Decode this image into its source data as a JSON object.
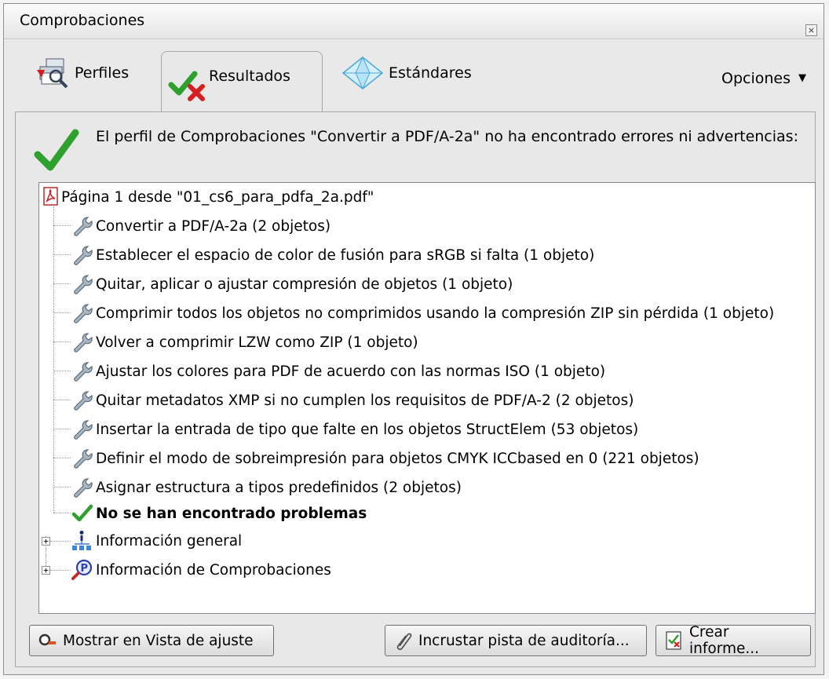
{
  "window": {
    "title": "Comprobaciones",
    "close_glyph": "×"
  },
  "tabs": [
    {
      "label": "Perfiles",
      "icon": "profiles-icon",
      "active": false
    },
    {
      "label": "Resultados",
      "icon": "results-icon",
      "active": true
    },
    {
      "label": "Estándares",
      "icon": "standards-icon",
      "active": false
    }
  ],
  "options": {
    "label": "Opciones",
    "caret": "▼"
  },
  "summary": {
    "message": "El perfil de Comprobaciones \"Convertir a PDF/A-2a\" no ha encontrado errores ni advertencias:"
  },
  "tree": {
    "root": {
      "label": "Página 1 desde \"01_cs6_para_pdfa_2a.pdf\"",
      "icon": "pdf-icon"
    },
    "fixups": [
      "Convertir a PDF/A-2a (2 objetos)",
      "Establecer el espacio de color de fusión para sRGB si falta (1 objeto)",
      "Quitar, aplicar o ajustar compresión de objetos (1 objeto)",
      "Comprimir todos los objetos no comprimidos usando la compresión ZIP sin pérdida (1 objeto)",
      "Volver a comprimir LZW como ZIP (1 objeto)",
      "Ajustar los colores para PDF de acuerdo con las normas ISO (1 objeto)",
      "Quitar metadatos XMP si no cumplen los requisitos de PDF/A-2 (2 objetos)",
      "Insertar la entrada de tipo que falte en los objetos StructElem (53 objetos)",
      "Definir el modo de sobreimpresión para objetos CMYK ICCbased en 0 (221 objetos)",
      "Asignar estructura a tipos predefinidos (2 objetos)"
    ],
    "no_problems": "No se han encontrado problemas",
    "general_info": "Información general",
    "preflight_info": "Información de Comprobaciones",
    "expand_glyph": "+"
  },
  "buttons": {
    "show_fixup": "Mostrar en Vista de ajuste",
    "embed_audit": "Incrustar pista de auditoría...",
    "create_report": "Crear informe..."
  },
  "colors": {
    "check_green": "#2ea02e",
    "cross_red": "#d42020",
    "pdf_red": "#d11f1f",
    "wrench_gray": "#7a8c9a"
  }
}
